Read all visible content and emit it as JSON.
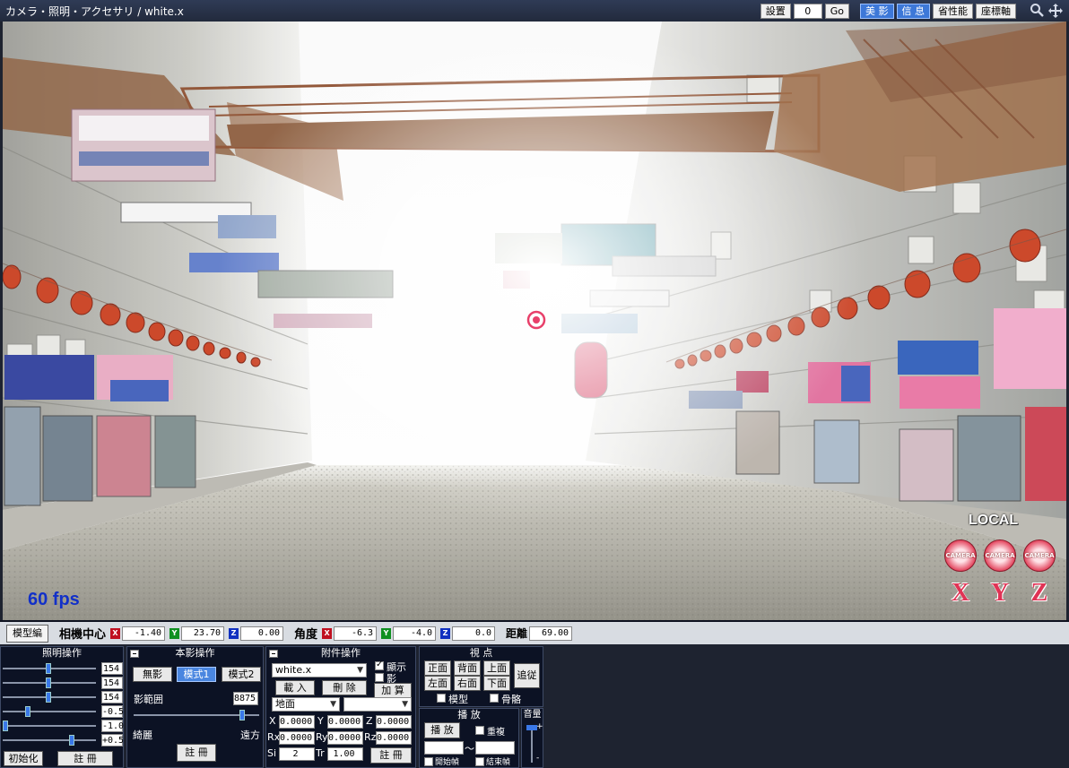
{
  "title": "カメラ・照明・アクセサリ / white.x",
  "toolbar": {
    "setting_label": "設置",
    "frame_value": "0",
    "go_label": "Go",
    "beauty_label": "美 影",
    "info_label": "信 息",
    "perf_label": "省性能",
    "axis_label": "座標軸",
    "icons": [
      "search-icon",
      "move-icon"
    ]
  },
  "viewport": {
    "fps": "60 fps",
    "local_label": "LOCAL",
    "gizmo_label": "CAMERA",
    "axis_x": "X",
    "axis_y": "Y",
    "axis_z": "Z"
  },
  "camerabar": {
    "mode_button": "模型編",
    "center_label": "相機中心",
    "center": {
      "x": "-1.40",
      "y": "23.70",
      "z": "0.00"
    },
    "angle_label": "角度",
    "angle": {
      "x": "-6.3",
      "y": "-4.0",
      "z": "0.0"
    },
    "distance_label": "距離",
    "distance": "69.00",
    "axis_letters": {
      "x": "X",
      "y": "Y",
      "z": "Z"
    }
  },
  "lighting": {
    "title": "照明操作",
    "sliders": [
      {
        "value": "154",
        "level": 0.49
      },
      {
        "value": "154",
        "level": 0.49
      },
      {
        "value": "154",
        "level": 0.49
      },
      {
        "value": "-0.5",
        "level": 0.25
      },
      {
        "value": "-1.0",
        "level": 0.0
      },
      {
        "value": "+0.5",
        "level": 0.75
      }
    ],
    "init_button": "初始化",
    "register_button": "註 冊"
  },
  "shadow": {
    "title": "本影操作",
    "none_button": "無影",
    "mode1_button": "模式1",
    "mode2_button": "模式2",
    "range_label": "影範囲",
    "range_value": "8875",
    "range_level": 0.88,
    "near_label": "綺麗",
    "far_label": "遠方",
    "register_button": "註 冊"
  },
  "accessory": {
    "title": "附件操作",
    "selected": "white.x",
    "show_label": "顯示",
    "shadow_label": "影",
    "load_button": "載 入",
    "delete_button": "刪 除",
    "add_button": "加 算",
    "parent_select": "地面",
    "bone_select": "",
    "x_label": "X",
    "x_value": "0.0000",
    "y_label": "Y",
    "y_value": "0.0000",
    "z_label": "Z",
    "z_value": "0.0000",
    "rx_label": "Rx",
    "rx_value": "0.0000",
    "ry_label": "Ry",
    "ry_value": "0.0000",
    "rz_label": "Rz",
    "rz_value": "0.0000",
    "si_label": "Si",
    "si_value": "2",
    "tr_label": "Tr",
    "tr_value": "1.00",
    "register_button": "註 冊"
  },
  "view": {
    "title": "視 点",
    "front": "正面",
    "back": "背面",
    "top": "上面",
    "left": "左面",
    "right": "右面",
    "bottom": "下面",
    "follow": "追従",
    "model_label": "模型",
    "bone_label": "骨骼"
  },
  "play": {
    "title": "播 放",
    "play_button": "播 放",
    "repeat_label": "重複",
    "tilde": "〜",
    "start_label": "開始幀",
    "end_label": "結束幀"
  },
  "volume": {
    "title": "音量",
    "plus": "+",
    "minus": "-"
  }
}
